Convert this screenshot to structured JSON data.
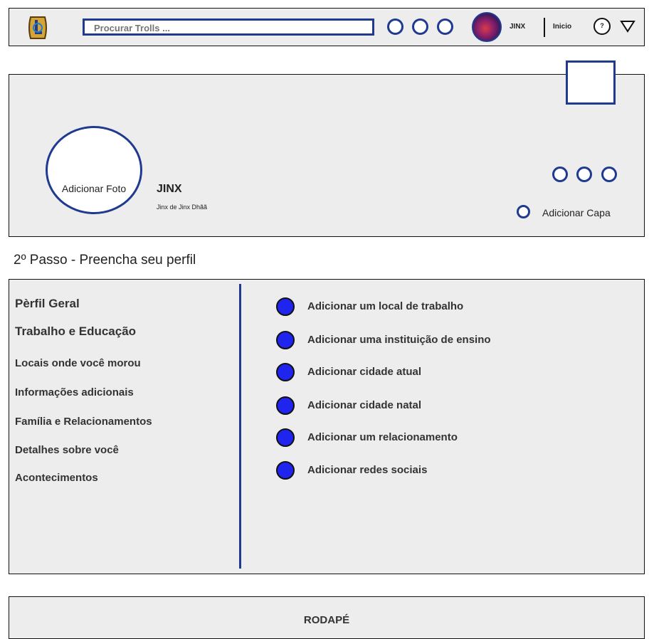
{
  "topbar": {
    "search_placeholder": "Procurar Trolls ...",
    "username": "JINX",
    "home_link": "Inicio",
    "help_symbol": "?"
  },
  "profile": {
    "add_photo": "Adicionar Foto",
    "name": "JINX",
    "subtitle": "Jinx de Jinx Dhãã",
    "add_cover": "Adicionar Capa"
  },
  "step_title": "2º Passo - Preencha seu perfil",
  "nav": [
    {
      "label": "Pèrfil Geral"
    },
    {
      "label": "Trabalho e Educação"
    },
    {
      "label": "Locais onde você morou"
    },
    {
      "label": "Informações adicionais"
    },
    {
      "label": "Família e Relacionamentos"
    },
    {
      "label": "Detalhes sobre você"
    },
    {
      "label": "Acontecimentos"
    }
  ],
  "actions": [
    {
      "label": "Adicionar um local de trabalho"
    },
    {
      "label": "Adicionar uma instituição de ensino"
    },
    {
      "label": "Adicionar cidade atual"
    },
    {
      "label": "Adicionar cidade natal"
    },
    {
      "label": "Adicionar um relacionamento"
    },
    {
      "label": "Adicionar redes sociais"
    }
  ],
  "footer": {
    "label": "RODAPÉ"
  },
  "colors": {
    "accent": "#1f3a8f",
    "bullet": "#1f24ee",
    "panel": "#ededed"
  }
}
